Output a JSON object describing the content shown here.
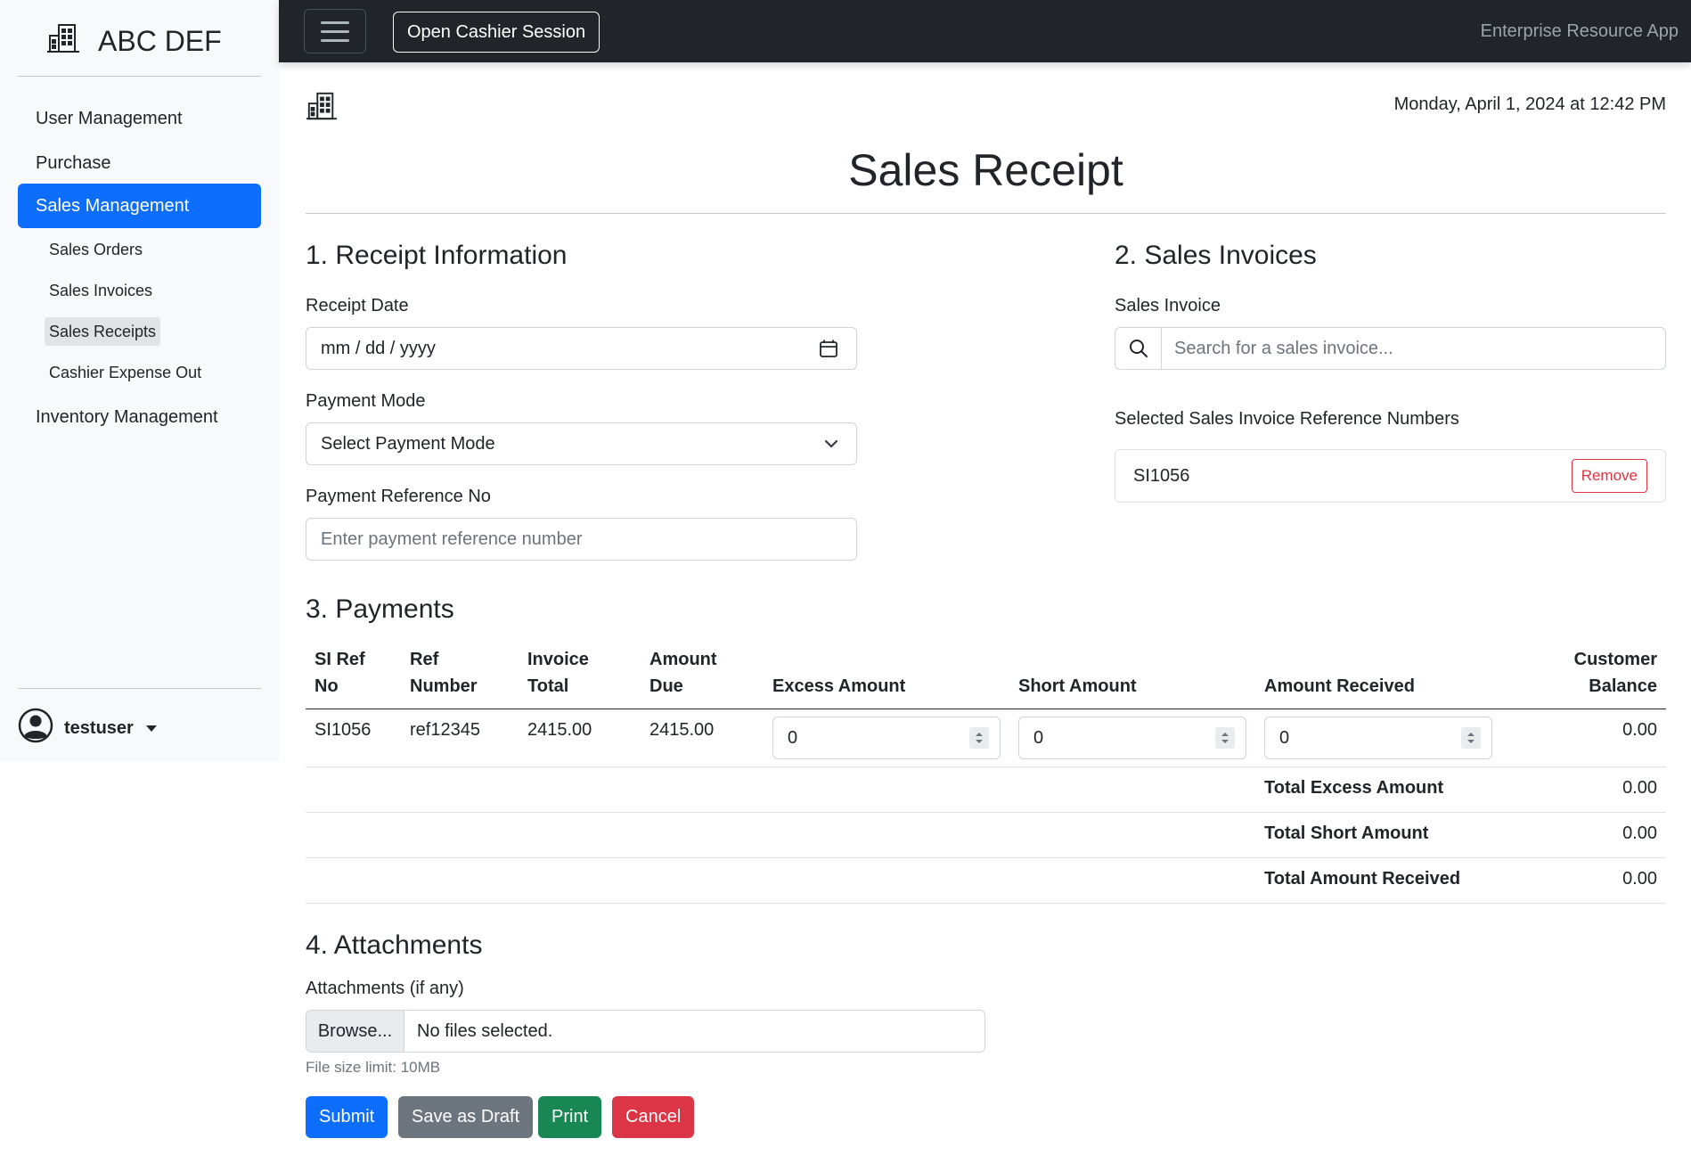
{
  "sidebar": {
    "brand": "ABC DEF",
    "items": [
      {
        "label": "User Management"
      },
      {
        "label": "Purchase"
      },
      {
        "label": "Sales Management"
      },
      {
        "label": "Inventory Management"
      }
    ],
    "sub_items": [
      {
        "label": "Sales Orders"
      },
      {
        "label": "Sales Invoices"
      },
      {
        "label": "Sales Receipts"
      },
      {
        "label": "Cashier Expense Out"
      }
    ],
    "active_item": "Sales Management",
    "active_sub_item": "Sales Receipts",
    "user": "testuser"
  },
  "topbar": {
    "cashier_button": "Open Cashier Session",
    "app_name": "Enterprise Resource App"
  },
  "header": {
    "datetime": "Monday, April 1, 2024 at 12:42 PM",
    "title": "Sales Receipt"
  },
  "receipt_info": {
    "heading": "1. Receipt Information",
    "date_label": "Receipt Date",
    "date_value": "mm / dd / yyyy",
    "payment_mode_label": "Payment Mode",
    "payment_mode_value": "Select Payment Mode",
    "ref_label": "Payment Reference No",
    "ref_placeholder": "Enter payment reference number"
  },
  "sales_invoices": {
    "heading": "2. Sales Invoices",
    "label": "Sales Invoice",
    "search_placeholder": "Search for a sales invoice...",
    "selected_label": "Selected Sales Invoice Reference Numbers",
    "selected": [
      {
        "ref": "SI1056",
        "remove_label": "Remove"
      }
    ]
  },
  "payments": {
    "heading": "3. Payments",
    "columns": {
      "si_ref": "SI Ref No",
      "ref_number": "Ref Number",
      "invoice_total": "Invoice Total",
      "amount_due": "Amount Due",
      "excess": "Excess Amount",
      "short": "Short Amount",
      "received": "Amount Received",
      "balance": "Customer Balance"
    },
    "rows": [
      {
        "si_ref": "SI1056",
        "ref_number": "ref12345",
        "invoice_total": "2415.00",
        "amount_due": "2415.00",
        "excess": "0",
        "short": "0",
        "received": "0",
        "balance": "0.00"
      }
    ],
    "totals": [
      {
        "label": "Total Excess Amount",
        "value": "0.00"
      },
      {
        "label": "Total Short Amount",
        "value": "0.00"
      },
      {
        "label": "Total Amount Received",
        "value": "0.00"
      }
    ]
  },
  "attachments": {
    "heading": "4. Attachments",
    "label": "Attachments (if any)",
    "browse": "Browse...",
    "file_text": "No files selected.",
    "hint": "File size limit: 10MB"
  },
  "actions": {
    "submit": "Submit",
    "draft": "Save as Draft",
    "print": "Print",
    "cancel": "Cancel"
  },
  "colors": {
    "primary": "#0d6efd",
    "secondary": "#6c757d",
    "success": "#198754",
    "danger": "#dc3545",
    "topbar": "#212529",
    "sidebar": "#f8f9fa"
  },
  "icons": {
    "brand": "building-icon",
    "header": "building-icon",
    "date": "calendar-icon",
    "select": "chevron-down-icon",
    "search": "search-icon",
    "user": "user-circle-icon"
  }
}
